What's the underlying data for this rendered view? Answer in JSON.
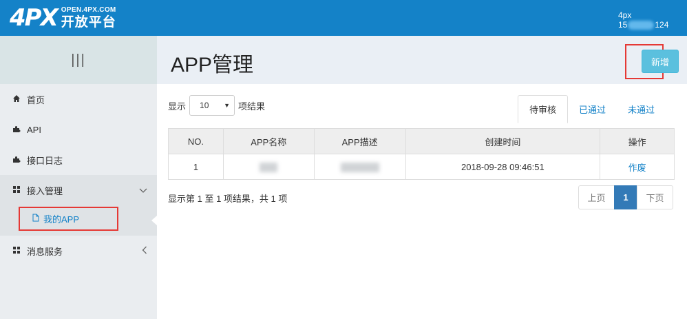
{
  "header": {
    "logo_mark": "4PX",
    "logo_domain": "OPEN.4PX.COM",
    "logo_name": "开放平台",
    "user_name": "4px",
    "user_phone_start": "15",
    "user_phone_end": "124"
  },
  "sidebar": {
    "toggle_icon": "|||",
    "items": [
      {
        "label": "首页",
        "icon": "home-icon"
      },
      {
        "label": "API",
        "icon": "puzzle-icon"
      },
      {
        "label": "接口日志",
        "icon": "puzzle-icon"
      },
      {
        "label": "接入管理",
        "icon": "grid-icon",
        "expanded": true
      },
      {
        "label": "消息服务",
        "icon": "grid-icon",
        "expanded": false
      }
    ],
    "sub_item_label": "我的APP"
  },
  "main": {
    "title": "APP管理",
    "add_button": "新增",
    "show_label": "显示",
    "page_size": "10",
    "results_label": "项结果",
    "tabs": [
      "待审核",
      "已通过",
      "未通过"
    ],
    "active_tab": 0,
    "table": {
      "columns": [
        "NO.",
        "APP名称",
        "APP描述",
        "创建时间",
        "操作"
      ],
      "rows": [
        {
          "no": "1",
          "created": "2018-09-28 09:46:51",
          "action": "作废"
        }
      ]
    },
    "summary": "显示第 1 至 1 项结果，共 1 项",
    "pagination": {
      "prev": "上页",
      "current": "1",
      "next": "下页"
    }
  },
  "colors": {
    "brand": "#1482c8",
    "add_button": "#5bc0de",
    "highlight": "#e53935",
    "pagination_active": "#337ab7"
  }
}
